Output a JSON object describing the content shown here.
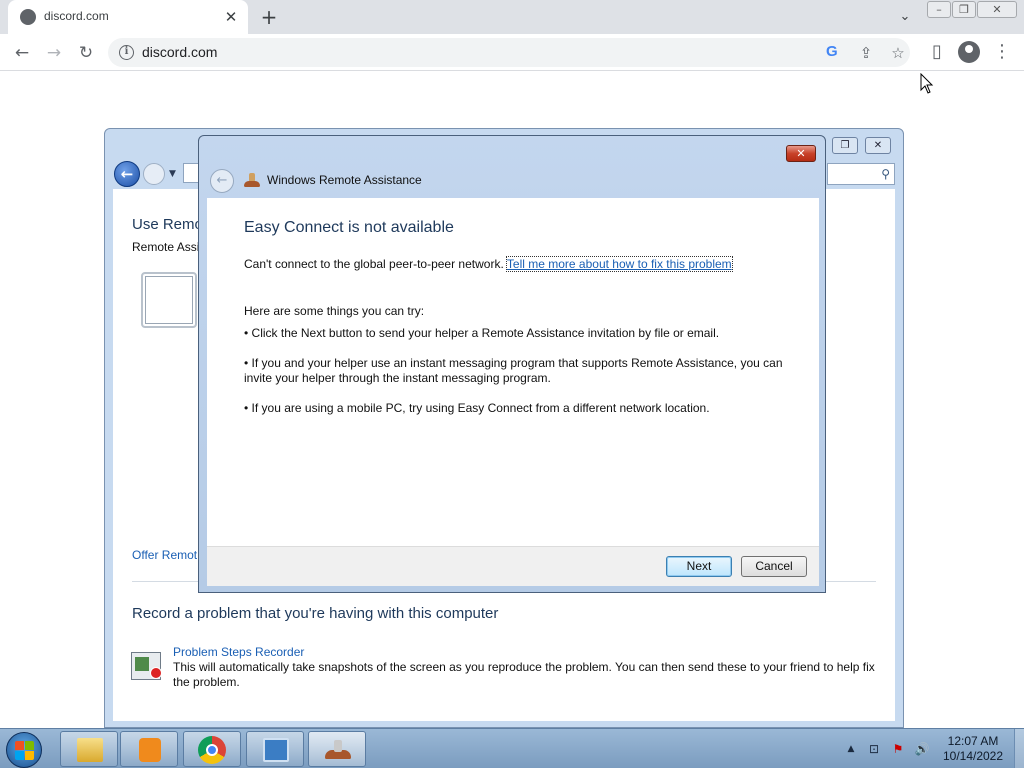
{
  "browser": {
    "tab_title": "discord.com",
    "tab_close": "✕",
    "new_tab": "+",
    "tab_search": "⌄",
    "window_buttons": {
      "minimize": "–",
      "restore": "❐",
      "close": "✕"
    },
    "back": "←",
    "forward": "→",
    "reload": "↻",
    "url": "discord.com",
    "info_icon": "i",
    "google_icon": "G",
    "share_icon": "⇪",
    "bookmark_icon": "☆",
    "sidepanel_icon": "▯",
    "menu_icon": "⋮"
  },
  "help_window": {
    "title": "Use Remo",
    "subtitle": "Remote Assi",
    "offer_link": "Offer Remot",
    "record_heading": "Record a problem that you're having with this computer",
    "psr_link": "Problem Steps Recorder",
    "psr_desc": "This will automatically take snapshots of the screen as you reproduce the problem. You can then send these to your friend to help fix the problem.",
    "search_icon": "⚲",
    "buttons": {
      "restore": "❐",
      "close": "✕"
    },
    "back_arrow": "←"
  },
  "dialog": {
    "title": "Windows Remote Assistance",
    "close": "✕",
    "back_arrow": "←",
    "heading": "Easy Connect is not available",
    "error_text": "Can't connect to the global peer-to-peer network.",
    "error_link": "Tell me more about how to fix this problem",
    "tips_intro": "Here are some things you can try:",
    "tips": [
      "• Click the Next button to send your helper a Remote Assistance invitation by file or email.",
      "• If you and your helper use an instant messaging program that supports Remote Assistance, you can invite your helper through the instant messaging program.",
      "• If you are using a mobile PC, try using Easy Connect from a different network location."
    ],
    "next_label": "Next",
    "cancel_label": "Cancel"
  },
  "taskbar": {
    "items": [
      "file-explorer",
      "media-player",
      "chrome",
      "control-panel",
      "remote-assistance"
    ],
    "tray": {
      "arrow": "▲",
      "network": "⊡",
      "flag": "⚑",
      "volume": "🔊"
    },
    "time": "12:07 AM",
    "date": "10/14/2022"
  }
}
